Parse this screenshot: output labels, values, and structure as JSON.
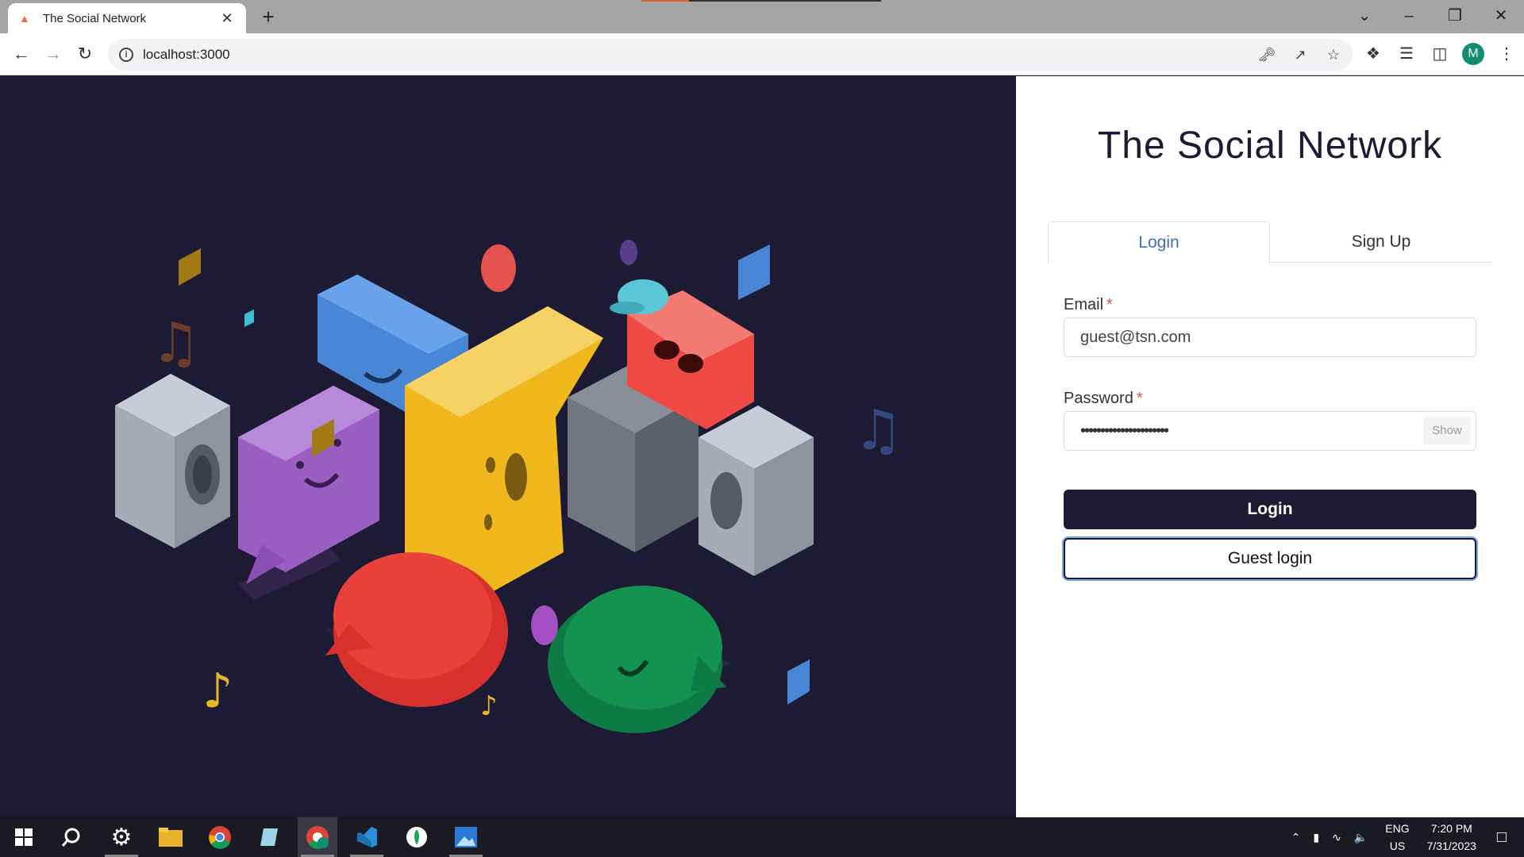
{
  "browser": {
    "tab_title": "The Social Network",
    "url": "localhost:3000",
    "profile_initial": "M"
  },
  "page": {
    "title": "The Social Network",
    "tabs": [
      {
        "label": "Login",
        "active": true
      },
      {
        "label": "Sign Up",
        "active": false
      }
    ],
    "email": {
      "label": "Email",
      "required_mark": "*",
      "value": "guest@tsn.com"
    },
    "password": {
      "label": "Password",
      "required_mark": "*",
      "value_masked": "••••••••••••••••••••••",
      "show_label": "Show"
    },
    "login_button": "Login",
    "guest_button": "Guest login"
  },
  "taskbar": {
    "apps": [
      "windows-start",
      "search",
      "settings",
      "file-explorer",
      "chrome",
      "notepad",
      "chrome-profile",
      "vscode",
      "mongodb-compass",
      "photos"
    ],
    "language": "ENG",
    "region": "US",
    "time": "7:20 PM",
    "date": "7/31/2023"
  },
  "colors": {
    "hero_bg": "#1d1a33",
    "accent_tab": "#3d6fb5",
    "button_dark": "#1d1a33",
    "required": "#d9534f"
  }
}
